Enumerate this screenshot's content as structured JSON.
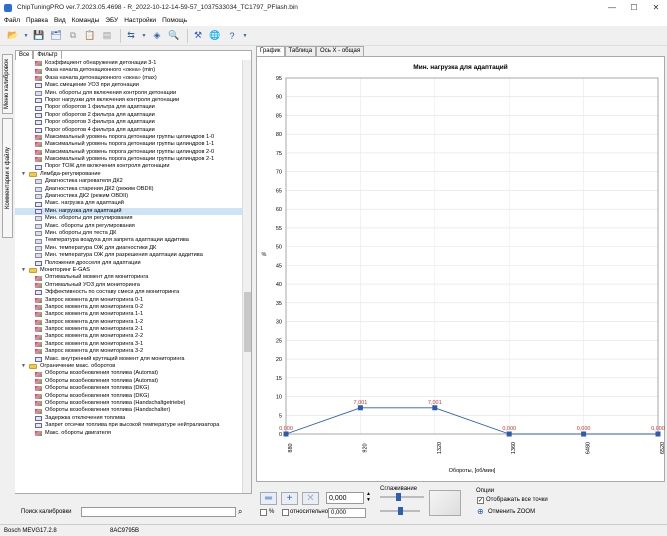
{
  "window": {
    "title": "ChipTuningPRO ver.7.2023.05.4698 - R_2022-10-12-14-59-57_1037533034_TC1797_PFlash.bin"
  },
  "menu": [
    "Файл",
    "Правка",
    "Вид",
    "Команды",
    "ЭБУ",
    "Настройки",
    "Помощь"
  ],
  "side_tabs": {
    "calibrations": "Меню калибровок",
    "comments": "Комментарии к файлу"
  },
  "left_tabs": [
    "Все",
    "Фильтр"
  ],
  "tree": [
    {
      "t": "Коэффициент обнаружения детонации 3-1",
      "icon": "map",
      "lvl": 2
    },
    {
      "t": "Фаза начала детонационного «окна» (min)",
      "icon": "map",
      "lvl": 2
    },
    {
      "t": "Фаза начала детонационного «окна» (max)",
      "icon": "map",
      "lvl": 2
    },
    {
      "t": "Макс.смещение УОЗ при детонации",
      "icon": "curve",
      "lvl": 2
    },
    {
      "t": "Мин. обороты для включения контроля детонации",
      "icon": "scalar",
      "lvl": 2
    },
    {
      "t": "Порог нагрузки для включения контроля детонации",
      "icon": "curve",
      "lvl": 2
    },
    {
      "t": "Порог оборотов 1 фильтра для адаптации",
      "icon": "curve",
      "lvl": 2
    },
    {
      "t": "Порог оборотов 2 фильтра для адаптации",
      "icon": "curve",
      "lvl": 2
    },
    {
      "t": "Порог оборотов 3 фильтра для адаптации",
      "icon": "curve",
      "lvl": 2
    },
    {
      "t": "Порог оборотов 4 фильтра для адаптации",
      "icon": "curve",
      "lvl": 2
    },
    {
      "t": "Максимальный уровень порога детонации группы цилиндров 1-0",
      "icon": "map",
      "lvl": 2
    },
    {
      "t": "Максимальный уровень порога детонации группы цилиндров 1-1",
      "icon": "map",
      "lvl": 2
    },
    {
      "t": "Максимальный уровень порога детонации группы цилиндров 2-0",
      "icon": "map",
      "lvl": 2
    },
    {
      "t": "Максимальный уровень порога детонации группы цилиндров 2-1",
      "icon": "map",
      "lvl": 2
    },
    {
      "t": "Порог ТОЖ для включения контроля детонации",
      "icon": "curve",
      "lvl": 2
    },
    {
      "t": "Лямбда-регулирование",
      "icon": "folder",
      "lvl": 1,
      "exp": "▼"
    },
    {
      "t": "Диагностика нагревателя ДК2",
      "icon": "scalar",
      "lvl": 2
    },
    {
      "t": "Диагностика старения ДК2 (режим OBDII)",
      "icon": "scalar",
      "lvl": 2
    },
    {
      "t": "Диагностика ДК2 (режим OBDII)",
      "icon": "scalar",
      "lvl": 2
    },
    {
      "t": "Макс. нагрузка для адаптаций",
      "icon": "curve",
      "lvl": 2
    },
    {
      "t": "Мин. нагрузка для адаптаций",
      "icon": "curve",
      "lvl": 2,
      "sel": true
    },
    {
      "t": "Мин. обороты для регулирования",
      "icon": "scalar",
      "lvl": 2
    },
    {
      "t": "Макс. обороты для регулирования",
      "icon": "scalar",
      "lvl": 2
    },
    {
      "t": "Мин. обороты для теста ДК",
      "icon": "scalar",
      "lvl": 2
    },
    {
      "t": "Температура воздуха для запрета адаптации аддитива",
      "icon": "scalar",
      "lvl": 2
    },
    {
      "t": "Мин. температура ОЖ для диагностики ДК",
      "icon": "scalar",
      "lvl": 2
    },
    {
      "t": "Мин. температура ОЖ для разрешения адаптации аддитива",
      "icon": "scalar",
      "lvl": 2
    },
    {
      "t": "Положения дросселя для адаптации",
      "icon": "curve",
      "lvl": 2
    },
    {
      "t": "Мониторинг E-GAS",
      "icon": "folder",
      "lvl": 1,
      "exp": "▼"
    },
    {
      "t": "Оптимальный момент для мониторинга",
      "icon": "map",
      "lvl": 2
    },
    {
      "t": "Оптимальный УОЗ для мониторинга",
      "icon": "map",
      "lvl": 2
    },
    {
      "t": "Эффективность по составу смеси для мониторинга",
      "icon": "curve",
      "lvl": 2
    },
    {
      "t": "Запрос момента для мониторинга 0-1",
      "icon": "map",
      "lvl": 2
    },
    {
      "t": "Запрос момента для мониторинга 0-2",
      "icon": "map",
      "lvl": 2
    },
    {
      "t": "Запрос момента для мониторинга 1-1",
      "icon": "map",
      "lvl": 2
    },
    {
      "t": "Запрос момента для мониторинга 1-2",
      "icon": "map",
      "lvl": 2
    },
    {
      "t": "Запрос момента для мониторинга 2-1",
      "icon": "map",
      "lvl": 2
    },
    {
      "t": "Запрос момента для мониторинга 2-2",
      "icon": "map",
      "lvl": 2
    },
    {
      "t": "Запрос момента для мониторинга 3-1",
      "icon": "map",
      "lvl": 2
    },
    {
      "t": "Запрос момента для мониторинга 3-2",
      "icon": "map",
      "lvl": 2
    },
    {
      "t": "Макс. внутренний крутящий момент для мониторинга",
      "icon": "curve",
      "lvl": 2
    },
    {
      "t": "Ограничение макс. оборотов",
      "icon": "folder",
      "lvl": 1,
      "exp": "▼"
    },
    {
      "t": "Обороты возобновления топлива (Automat)",
      "icon": "map",
      "lvl": 2
    },
    {
      "t": "Обороты возобновления топлива (Automat)",
      "icon": "map",
      "lvl": 2
    },
    {
      "t": "Обороты возобновления топлива (DKG)",
      "icon": "map",
      "lvl": 2
    },
    {
      "t": "Обороты возобновления топлива (DKG)",
      "icon": "map",
      "lvl": 2
    },
    {
      "t": "Обороты возобновления топлива (Handschaltgetriebe)",
      "icon": "map",
      "lvl": 2
    },
    {
      "t": "Обороты возобновления топлива (Handschalter)",
      "icon": "map",
      "lvl": 2
    },
    {
      "t": "Задержка отключения топлива",
      "icon": "curve",
      "lvl": 2
    },
    {
      "t": "Запрет отсечки топлива при высокой температуре нейтрализатора",
      "icon": "curve",
      "lvl": 2
    },
    {
      "t": "Макс. обороты двигателя",
      "icon": "map",
      "lvl": 2
    }
  ],
  "search": {
    "label": "Поиск калибровки",
    "value": ""
  },
  "right_tabs": [
    "График",
    "Таблица",
    "Ось X - общая"
  ],
  "chart_data": {
    "type": "line",
    "title": "Мин. нагрузка для адаптаций",
    "xlabel": "Обороты, [об/мин]",
    "ylabel": "%",
    "categories": [
      "880",
      "920",
      "1320",
      "1360",
      "6480",
      "6520"
    ],
    "values": [
      0.0,
      7.001,
      7.001,
      0.0,
      0.0,
      0.0
    ],
    "point_labels": [
      "0,000",
      "7,001",
      "7,001",
      "0,000",
      "0,000",
      "0,000"
    ],
    "ylim": [
      0,
      95
    ],
    "yticks": [
      0,
      5,
      10,
      15,
      20,
      25,
      30,
      35,
      40,
      45,
      50,
      55,
      60,
      65,
      70,
      75,
      80,
      85,
      90,
      95
    ],
    "grid": true,
    "line_color": "#2a5db0",
    "label_color": "#c0392b"
  },
  "controls": {
    "value_input": "0,000",
    "smoothing_label": "Сглаживание",
    "percent_label": "%",
    "relative_label": "относительно",
    "relative_value": "0,000",
    "options_label": "Опции",
    "show_all_points": "Отображать все точки",
    "reset_zoom": "Отменить ZOOM"
  },
  "status": {
    "ecu": "Bosch MEVG17.2.8",
    "checksum": "8AC9795B"
  }
}
